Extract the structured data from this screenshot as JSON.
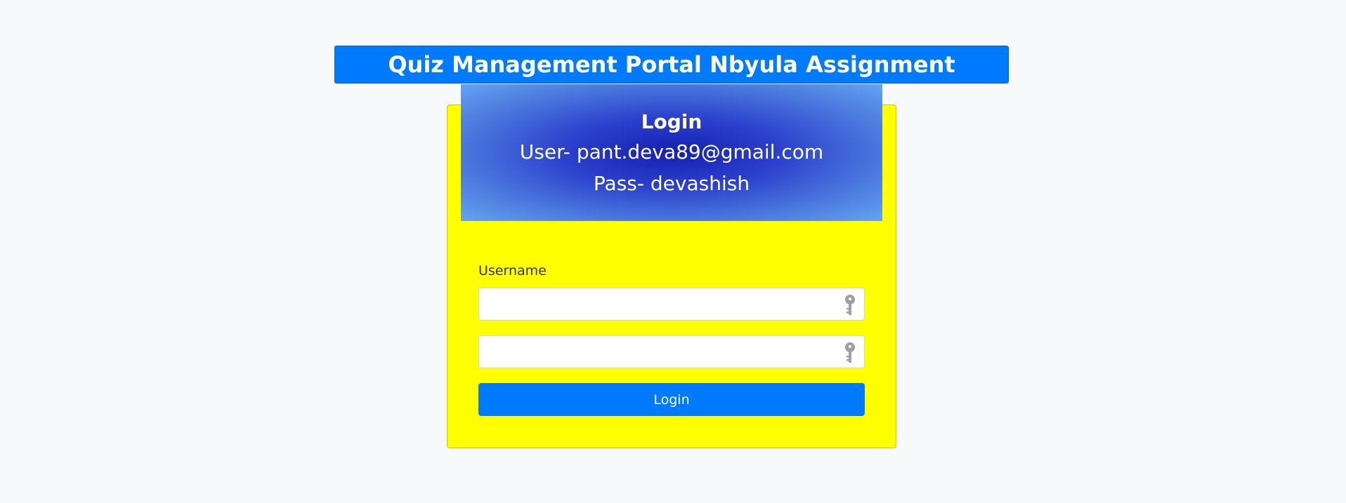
{
  "header": {
    "title": "Quiz Management Portal Nbyula Assignment"
  },
  "login_card": {
    "title": "Login",
    "user_hint": "User- pant.deva89@gmail.com",
    "pass_hint": "Pass- devashish",
    "username_label": "Username",
    "username_value": "",
    "password_value": "",
    "submit_label": "Login",
    "field_icon": "key-icon"
  },
  "colors": {
    "banner": "#007bff",
    "card_background": "#ffff00",
    "button": "#007bff",
    "header_gradient_center": "#1520b0",
    "header_gradient_edge": "#64a4f2"
  }
}
